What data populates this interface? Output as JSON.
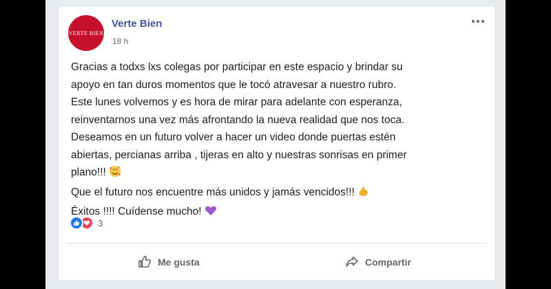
{
  "post": {
    "author": "Verte Bien",
    "avatar_text": "VERTE BIEN",
    "timestamp": "18 h",
    "lines": [
      "Gracias a todxs lxs colegas por participar en este espacio y brindar su",
      "apoyo en tan duros momentos que le tocó atravesar a nuestro rubro.",
      "Este lunes volvemos y es hora de mirar para adelante con esperanza,",
      "reinventarnos una vez más afrontando la nueva realidad que nos toca.",
      "Deseamos en un futuro volver a hacer un video donde puertas estén",
      "abiertas, percianas arriba , tijeras en alto y nuestras sonrisas en primer",
      "plano!!!",
      "Que el futuro nos encuentre más unidos y jamás vencidos!!!",
      "Éxitos !!!! Cuídense mucho!"
    ],
    "emojis": {
      "line7": "smiling-face-with-hearts-icon",
      "line8": "flexed-biceps-icon",
      "line9": "purple-heart-icon"
    }
  },
  "reactions": {
    "count": "3",
    "icons": [
      "like-icon",
      "love-icon"
    ]
  },
  "actions": {
    "like_label": "Me gusta",
    "share_label": "Compartir"
  },
  "colors": {
    "link": "#385898",
    "text": "#1c1e21",
    "muted": "#606770",
    "like_blue": "#1877f2",
    "love_red": "#f33e58",
    "avatar_red": "#c8102e"
  }
}
